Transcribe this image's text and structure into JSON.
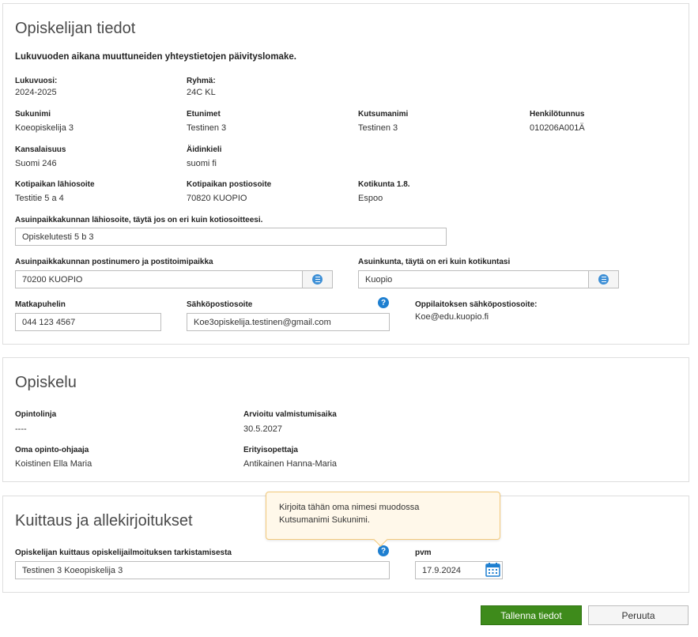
{
  "student_info": {
    "title": "Opiskelijan tiedot",
    "intro": "Lukuvuoden aikana muuttuneiden yhteystietojen päivityslomake.",
    "lukuvuosi": {
      "label": "Lukuvuosi:",
      "value": "2024-2025"
    },
    "ryhma": {
      "label": "Ryhmä:",
      "value": "24C KL"
    },
    "sukunimi": {
      "label": "Sukunimi",
      "value": "Koeopiskelija 3"
    },
    "etunimet": {
      "label": "Etunimet",
      "value": "Testinen 3"
    },
    "kutsumanimi": {
      "label": "Kutsumanimi",
      "value": "Testinen 3"
    },
    "henkilotunnus": {
      "label": "Henkilötunnus",
      "value": "010206A001Ä"
    },
    "kansalaisuus": {
      "label": "Kansalaisuus",
      "value": "Suomi 246"
    },
    "aidinkieli": {
      "label": "Äidinkieli",
      "value": "suomi fi"
    },
    "kotipaikan_lahiosoite": {
      "label": "Kotipaikan lähiosoite",
      "value": "Testitie 5 a 4"
    },
    "kotipaikan_postiosoite": {
      "label": "Kotipaikan postiosoite",
      "value": "70820 KUOPIO"
    },
    "kotikunta": {
      "label": "Kotikunta 1.8.",
      "value": "Espoo"
    },
    "asuinpaikka_lahiosoite": {
      "label": "Asuinpaikkakunnan lähiosoite, täytä jos on eri kuin kotiosoitteesi.",
      "value": "Opiskelutesti 5 b 3"
    },
    "asuinpaikka_postinumero": {
      "label": "Asuinpaikkakunnan postinumero ja postitoimipaikka",
      "value": "70200 KUOPIO"
    },
    "asuinkunta": {
      "label": "Asuinkunta, täytä on eri kuin kotikuntasi",
      "value": "Kuopio"
    },
    "matkapuhelin": {
      "label": "Matkapuhelin",
      "value": "044 123 4567"
    },
    "sahkoposti": {
      "label": "Sähköpostiosoite",
      "value": "Koe3opiskelija.testinen@gmail.com"
    },
    "oppilaitos_sahkoposti": {
      "label": "Oppilaitoksen sähköpostiosoite:",
      "value": "Koe@edu.kuopio.fi"
    }
  },
  "study": {
    "title": "Opiskelu",
    "opintolinja": {
      "label": "Opintolinja",
      "value": "----"
    },
    "valmistumisaika": {
      "label": "Arvioitu valmistumisaika",
      "value": "30.5.2027"
    },
    "ohjaaja": {
      "label": "Oma opinto-ohjaaja",
      "value": "Koistinen Ella Maria"
    },
    "erityisopettaja": {
      "label": "Erityisopettaja",
      "value": "Antikainen Hanna-Maria"
    }
  },
  "signatures": {
    "title": "Kuittaus ja allekirjoitukset",
    "kuittaus": {
      "label": "Opiskelijan kuittaus opiskelijailmoituksen tarkistamisesta",
      "value": "Testinen 3 Koeopiskelija 3"
    },
    "pvm": {
      "label": "pvm",
      "value": "17.9.2024"
    },
    "tooltip_line1": "Kirjoita tähän oma nimesi muodossa",
    "tooltip_line2": "Kutsumanimi Sukunimi."
  },
  "icons": {
    "help": "?",
    "list_picker": "list-icon",
    "calendar": "calendar-icon"
  },
  "actions": {
    "save_label": "Tallenna tiedot",
    "cancel_label": "Peruuta"
  },
  "colors": {
    "primary_button": "#3e8b1b",
    "help_icon": "#1e7fd0",
    "tooltip_bg": "#fff8ea",
    "tooltip_border": "#f3c97b"
  }
}
